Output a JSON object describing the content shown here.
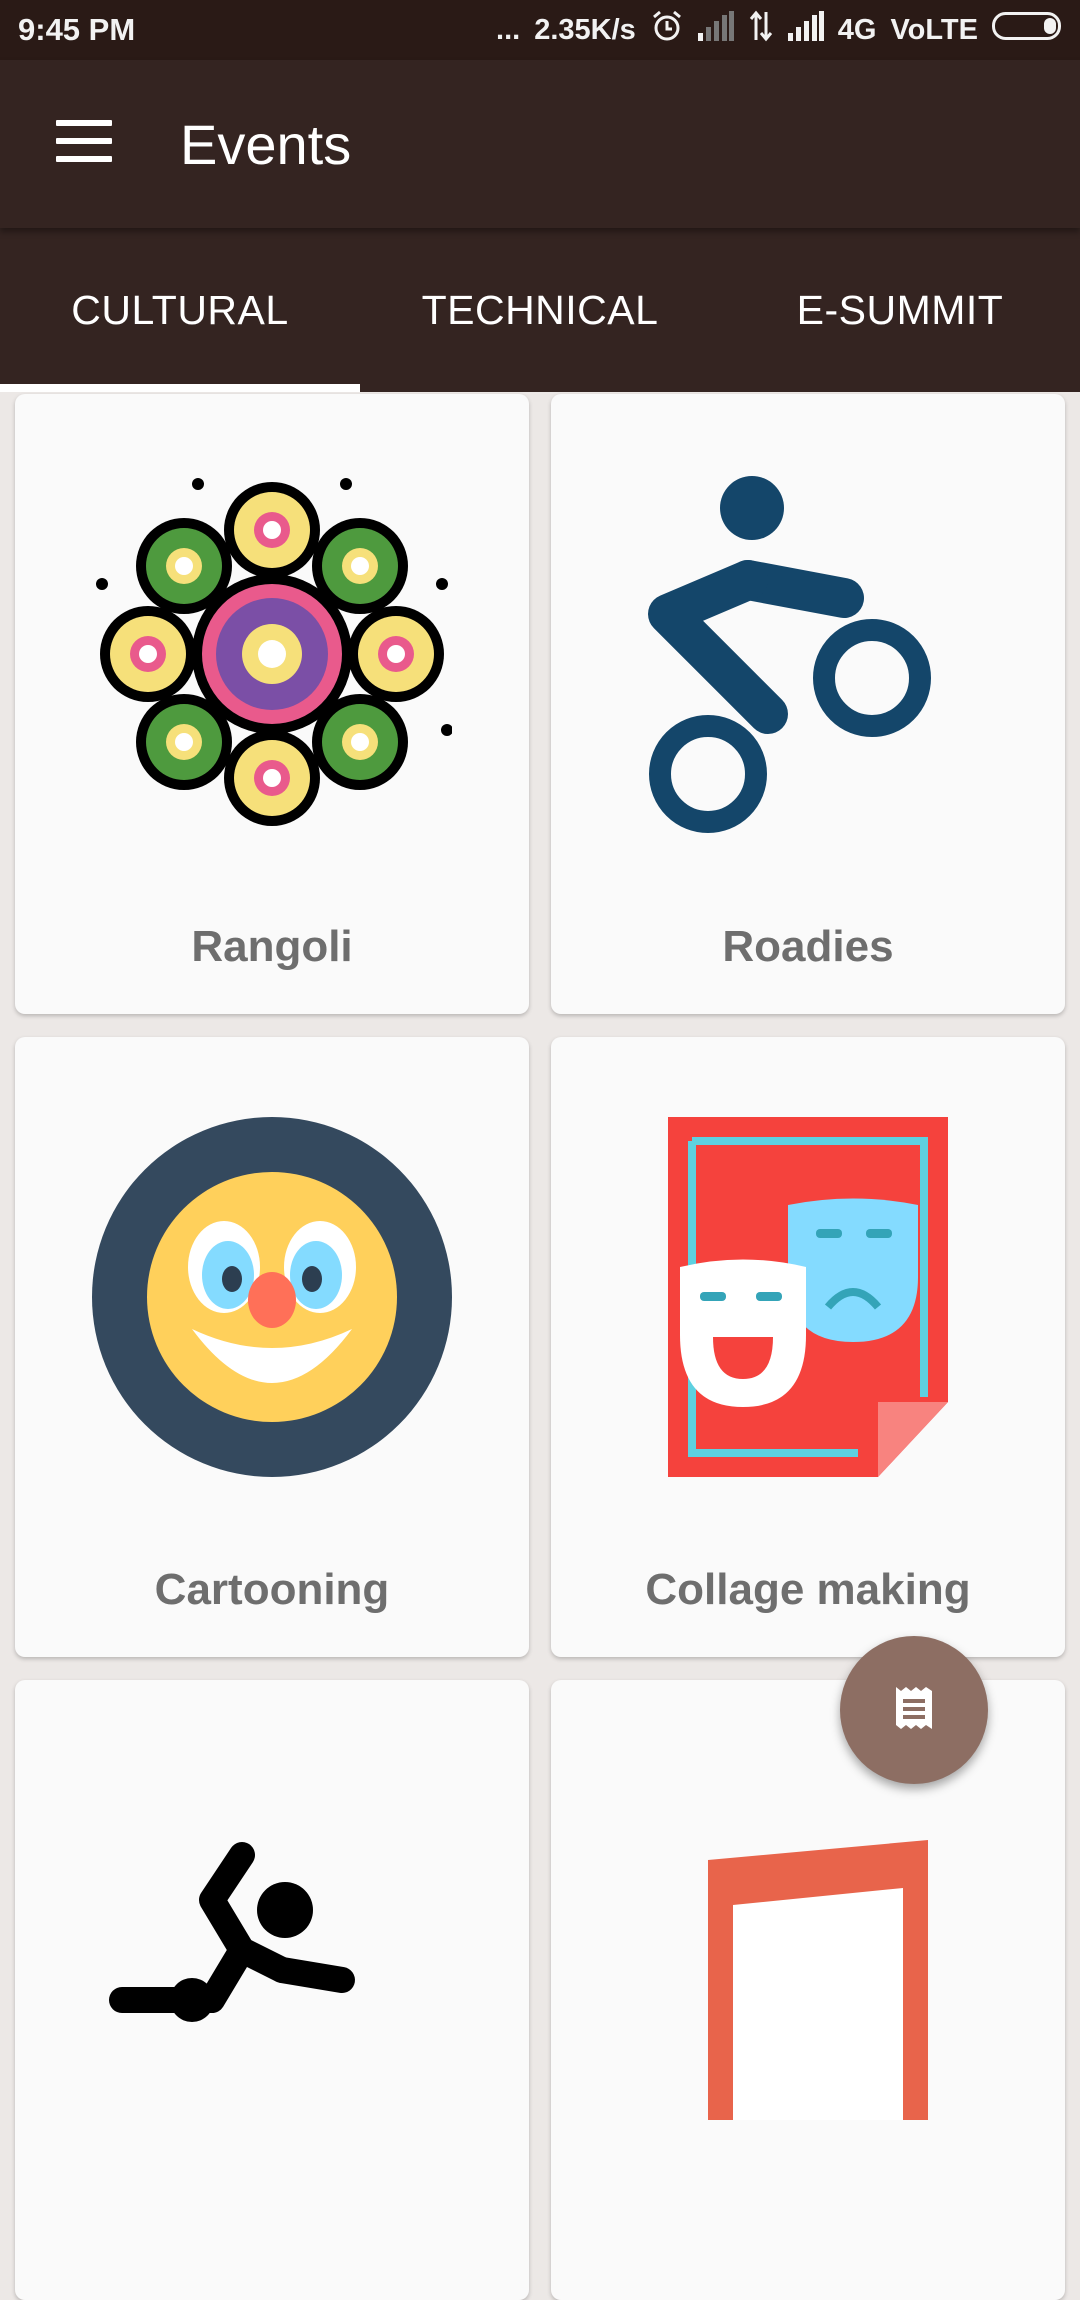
{
  "status_bar": {
    "time": "9:45 PM",
    "dots": "...",
    "speed": "2.35K/s",
    "network": "4G",
    "volte": "VoLTE",
    "icons": [
      "alarm-icon",
      "signal-icon",
      "data-arrows-icon",
      "signal-icon",
      "battery-icon"
    ]
  },
  "app_bar": {
    "title": "Events",
    "menu_icon": "hamburger-menu-icon"
  },
  "tabs": [
    {
      "label": "CULTURAL",
      "selected": true
    },
    {
      "label": "TECHNICAL",
      "selected": false
    },
    {
      "label": "E-SUMMIT",
      "selected": false
    }
  ],
  "events": [
    {
      "label": "Rangoli",
      "icon": "rangoli-icon"
    },
    {
      "label": "Roadies",
      "icon": "cyclist-icon"
    },
    {
      "label": "Cartooning",
      "icon": "clown-face-icon"
    },
    {
      "label": "Collage making",
      "icon": "drama-masks-icon"
    },
    {
      "label": "",
      "icon": "dancer-icon"
    },
    {
      "label": "",
      "icon": "music-note-icon"
    }
  ],
  "fab": {
    "icon": "receipt-icon"
  },
  "colors": {
    "status_bar": "#2A1A16",
    "primary": "#342421",
    "accent_fab": "#8D6E63",
    "background": "#ECE8E6",
    "card": "#FAFAFA",
    "card_label": "#6E6E6E"
  }
}
